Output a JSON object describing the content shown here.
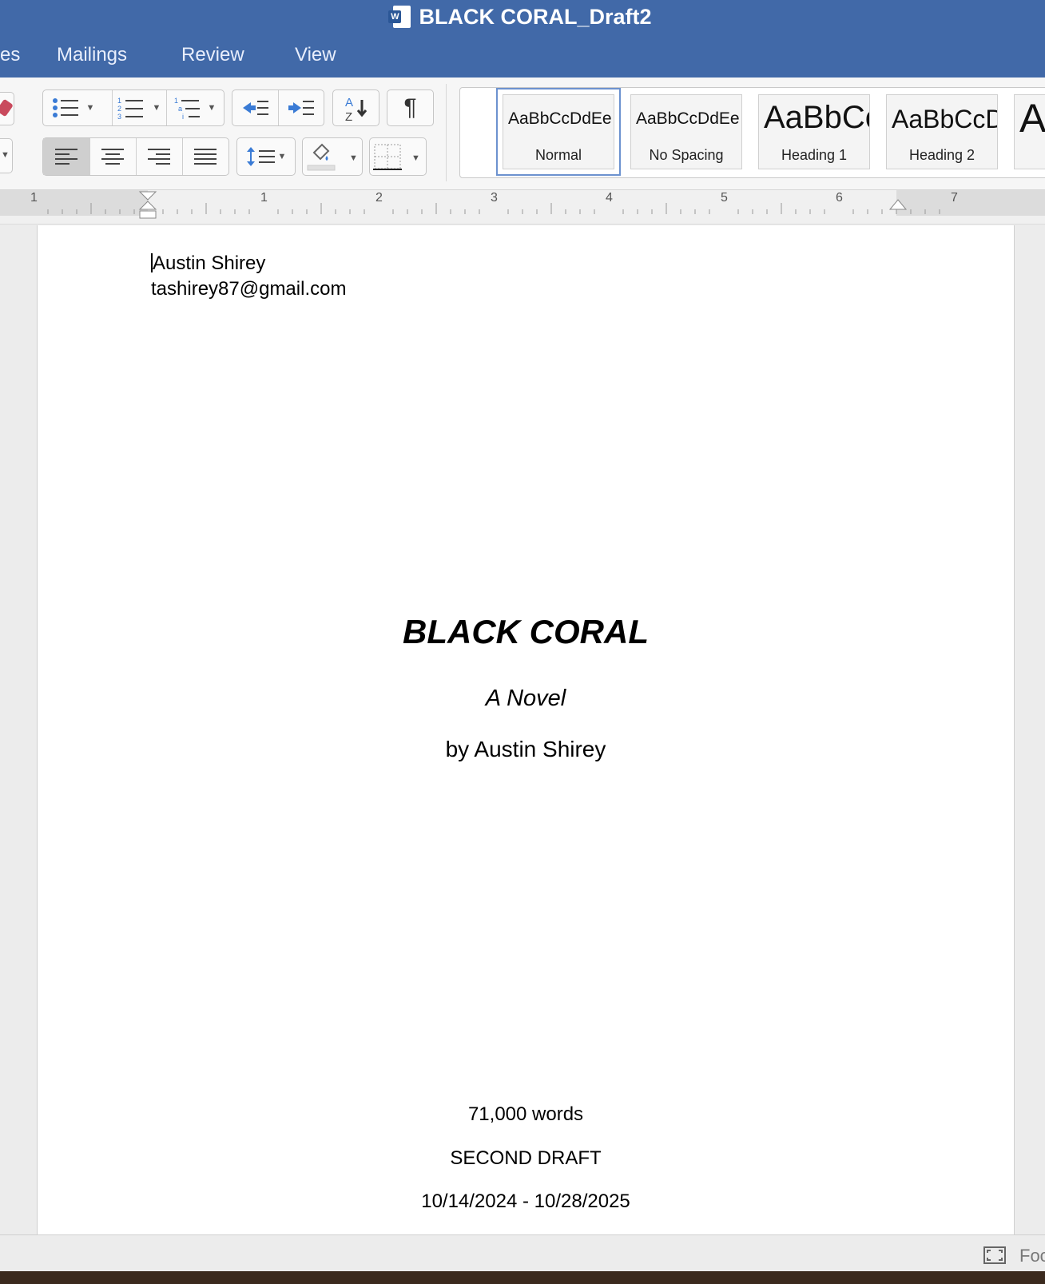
{
  "window": {
    "title": "BLACK CORAL_Draft2",
    "icon": "word-doc-icon"
  },
  "menu": {
    "items": [
      "es",
      "Mailings",
      "Review",
      "View"
    ]
  },
  "ribbon": {
    "pilcrow": "¶",
    "sort_label_top": "A",
    "sort_label_bottom": "Z",
    "styles": [
      {
        "sample": "AaBbCcDdEe",
        "name": "Normal"
      },
      {
        "sample": "AaBbCcDdEe",
        "name": "No Spacing"
      },
      {
        "sample": "AaBbCc",
        "name": "Heading 1"
      },
      {
        "sample": "AaBbCcD",
        "name": "Heading 2"
      },
      {
        "sample": "A",
        "name": ""
      }
    ]
  },
  "ruler": {
    "labels": [
      "1",
      "1",
      "2",
      "3",
      "4",
      "5",
      "6",
      "7"
    ]
  },
  "document": {
    "author": "Austin Shirey",
    "email": "tashirey87@gmail.com",
    "title": "BLACK CORAL",
    "subtitle": "A Novel",
    "byline": "by Austin Shirey",
    "word_count": "71,000 words",
    "draft": "SECOND DRAFT",
    "dates": "10/14/2024 - 10/28/2025"
  },
  "status": {
    "focus_label": "Foc"
  },
  "colors": {
    "titlebar": "#4169a8",
    "active_style_outline": "#6c92cf"
  }
}
